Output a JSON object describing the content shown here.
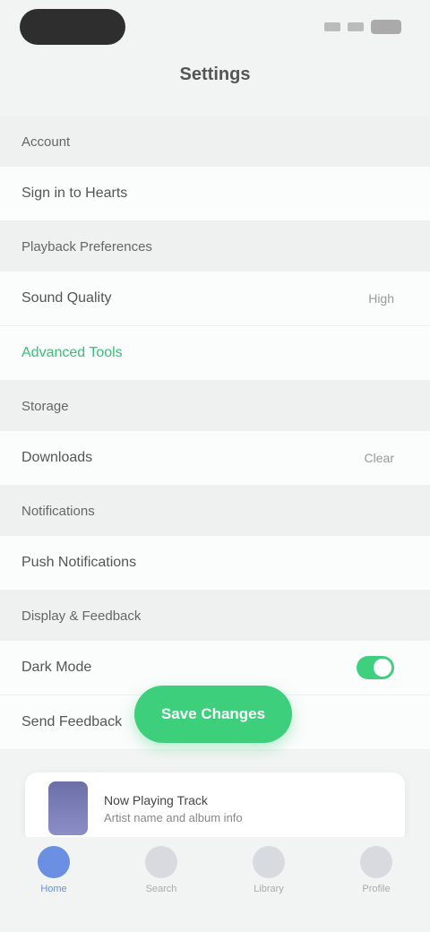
{
  "status": {
    "time": "",
    "pill": ""
  },
  "page": {
    "title": "Settings"
  },
  "sections": [
    {
      "header": "Account",
      "rows": [
        {
          "label": "Sign in to Hearts",
          "value": "",
          "type": "plain"
        }
      ]
    },
    {
      "header": "Playback Preferences",
      "rows": [
        {
          "label": "Sound Quality",
          "value": "High",
          "type": "plain"
        },
        {
          "label": "Advanced Tools",
          "value": "",
          "type": "link"
        }
      ]
    },
    {
      "header": "Storage",
      "rows": [
        {
          "label": "Downloads",
          "value": "Clear",
          "type": "plain"
        }
      ]
    },
    {
      "header": "Notifications",
      "rows": [
        {
          "label": "Push Notifications",
          "value": "",
          "type": "plain"
        }
      ]
    },
    {
      "header": "Display & Feedback",
      "rows": [
        {
          "label": "Dark Mode",
          "value": "",
          "type": "toggle"
        },
        {
          "label": "Send Feedback",
          "value": "",
          "type": "plain"
        }
      ]
    }
  ],
  "fab": {
    "label": "Save Changes"
  },
  "miniPlayer": {
    "title": "Now Playing Track",
    "subtitle": "Artist name and album info"
  },
  "tabs": [
    {
      "label": "Home",
      "active": true
    },
    {
      "label": "Search",
      "active": false
    },
    {
      "label": "Library",
      "active": false
    },
    {
      "label": "Profile",
      "active": false
    }
  ],
  "colors": {
    "accent": "#3ecf7c",
    "tabActive": "#6a8fe3"
  }
}
